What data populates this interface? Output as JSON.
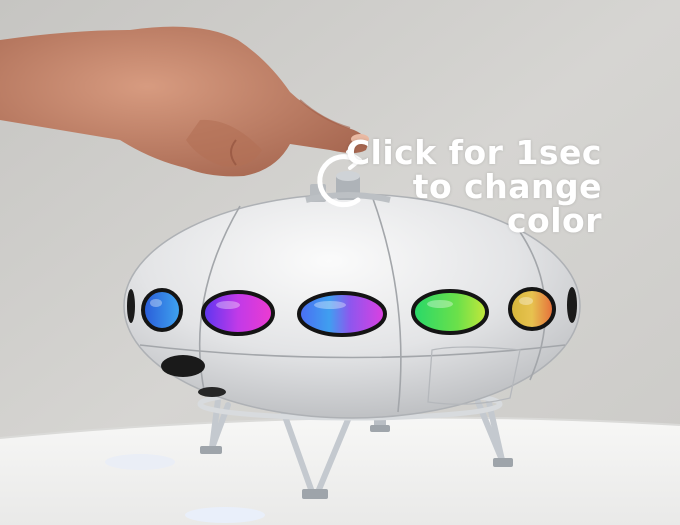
{
  "caption": {
    "line1": "Click for 1sec",
    "line2": "to change",
    "line3": "color"
  },
  "icons": {
    "press_indicator": "circular-arrow-icon"
  },
  "colors": {
    "background_wall": "#d3d2cf",
    "pedestal": "#f2f2f0",
    "ufo_body": "#e6e7e8",
    "caption_text": "#ffffff"
  }
}
